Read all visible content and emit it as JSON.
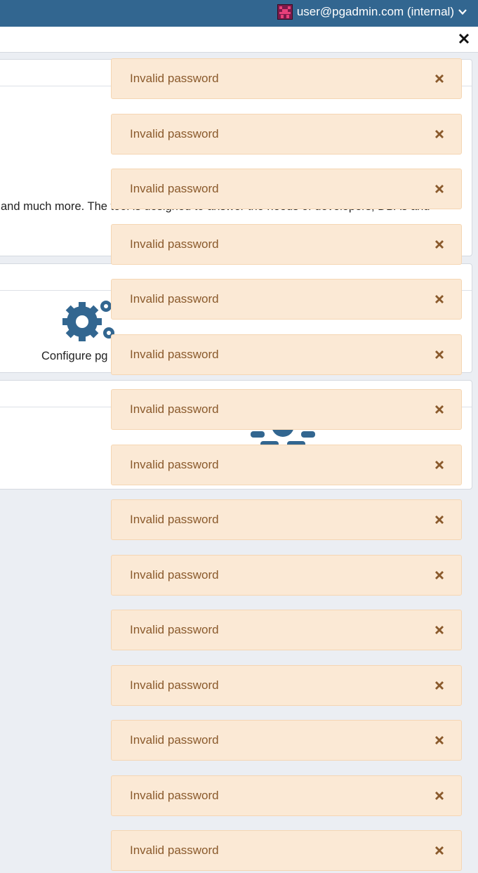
{
  "header": {
    "user_label": "user@pgadmin.com (internal)",
    "brand_color": "#326690"
  },
  "dashboard": {
    "welcome_text": "and much more. The tool is designed to answer the needs of developers, DBAs and",
    "configure_label": "Configure pg",
    "icon_color": "#326690"
  },
  "toasts": [
    {
      "message": "Invalid password"
    },
    {
      "message": "Invalid password"
    },
    {
      "message": "Invalid password"
    },
    {
      "message": "Invalid password"
    },
    {
      "message": "Invalid password"
    },
    {
      "message": "Invalid password"
    },
    {
      "message": "Invalid password"
    },
    {
      "message": "Invalid password"
    },
    {
      "message": "Invalid password"
    },
    {
      "message": "Invalid password"
    },
    {
      "message": "Invalid password"
    },
    {
      "message": "Invalid password"
    },
    {
      "message": "Invalid password"
    },
    {
      "message": "Invalid password"
    },
    {
      "message": "Invalid password"
    }
  ],
  "toast_colors": {
    "background": "#fbe9d5",
    "text": "#8a5a2c"
  }
}
